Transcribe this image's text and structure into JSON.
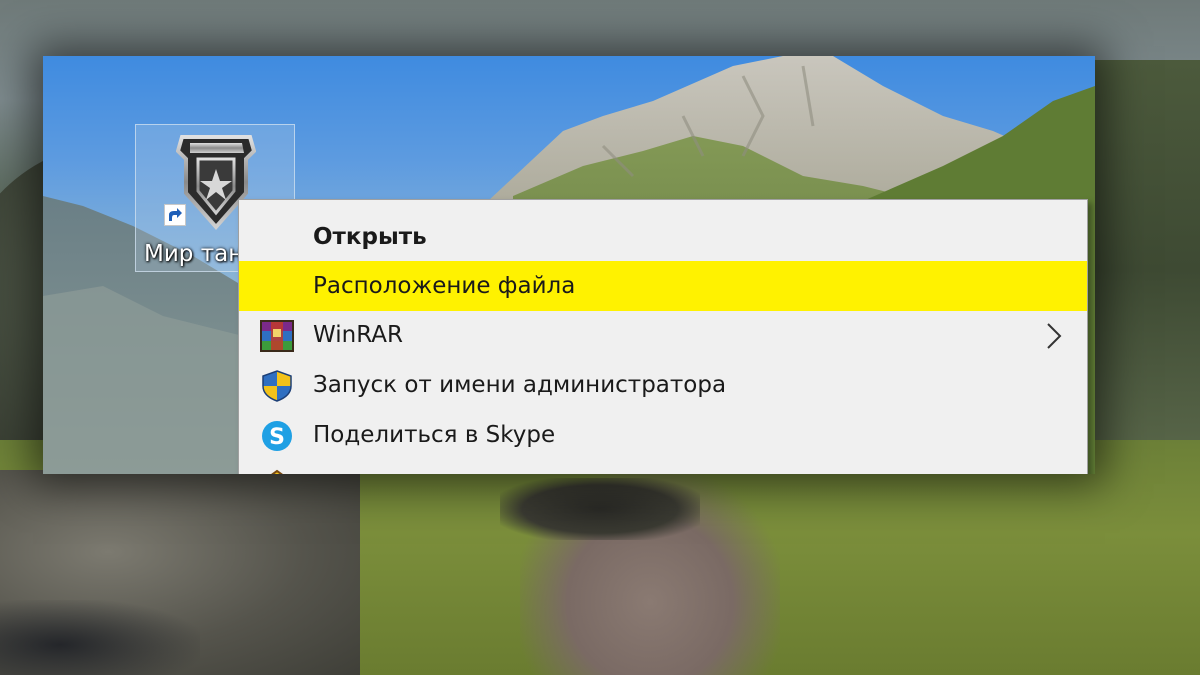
{
  "desktop": {
    "shortcut": {
      "icon": "mir-tankov-logo-icon",
      "label": "Мир тан"
    }
  },
  "context_menu": {
    "items": [
      {
        "label": "Открыть",
        "bold": true,
        "icon": "",
        "highlighted": false
      },
      {
        "label": "Расположение файла",
        "icon": "",
        "highlighted": true
      },
      {
        "label": "WinRAR",
        "icon": "winrar-icon",
        "submenu": true
      },
      {
        "label": "Запуск от имени администратора",
        "icon": "uac-shield-icon"
      },
      {
        "label": "Поделиться в Skype",
        "icon": "skype-icon"
      },
      {
        "icon": "compatibility-icon"
      }
    ],
    "highlight_color": "#fff200"
  }
}
